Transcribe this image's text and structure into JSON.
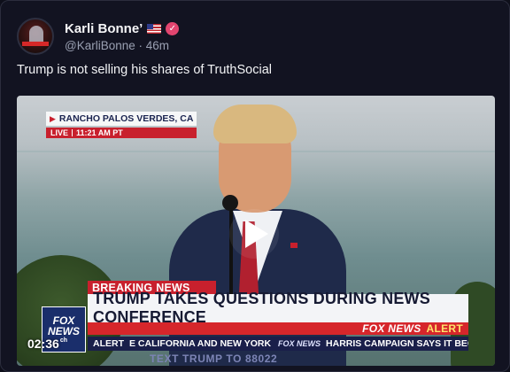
{
  "post": {
    "author": {
      "display_name": "Karli Bonne’",
      "handle": "@KarliBonne",
      "separator": "·",
      "time_ago": "46m",
      "flag": "us-flag-icon",
      "verified": "verified-badge-icon"
    },
    "text": "Trump is not selling his shares of TruthSocial"
  },
  "video": {
    "location": "RANCHO PALOS VERDES, CA",
    "live_label": "LIVE",
    "live_time": "11:21 AM PT",
    "breaking_label": "BREAKING",
    "breaking_news": "NEWS",
    "headline": "TRUMP TAKES QUESTIONS DURING NEWS CONFERENCE",
    "alert_strip_brand": "FOX NEWS",
    "alert_strip_word": "ALERT",
    "fox_logo": {
      "line1": "FOX",
      "line2": "NEWS",
      "line3": "ch"
    },
    "ticker": {
      "label": "ALERT",
      "items": [
        "E CALIFORNIA AND NEW YORK",
        "HARRIS CAMPAIGN SAYS IT BEGAI"
      ],
      "brand": "FOX NEWS"
    },
    "text_prompt": "TEXT TRUMP TO 88022",
    "timestamp": "02:36",
    "play_icon": "play-icon"
  },
  "colors": {
    "background": "#121321",
    "accent_red": "#c8202d",
    "verified_pink": "#e2456f"
  }
}
